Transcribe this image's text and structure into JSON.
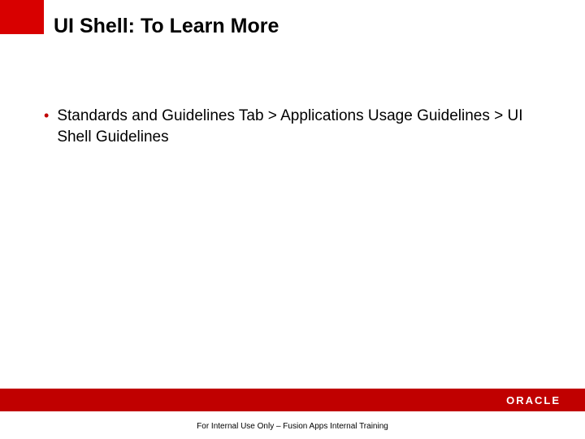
{
  "header": {
    "title": "UI  Shell: To Learn More"
  },
  "content": {
    "bullets": [
      {
        "text": "Standards and Guidelines Tab > Applications Usage Guidelines > UI Shell Guidelines"
      }
    ]
  },
  "footer": {
    "logo": "ORACLE",
    "caption": "For Internal Use Only – Fusion Apps Internal Training"
  }
}
